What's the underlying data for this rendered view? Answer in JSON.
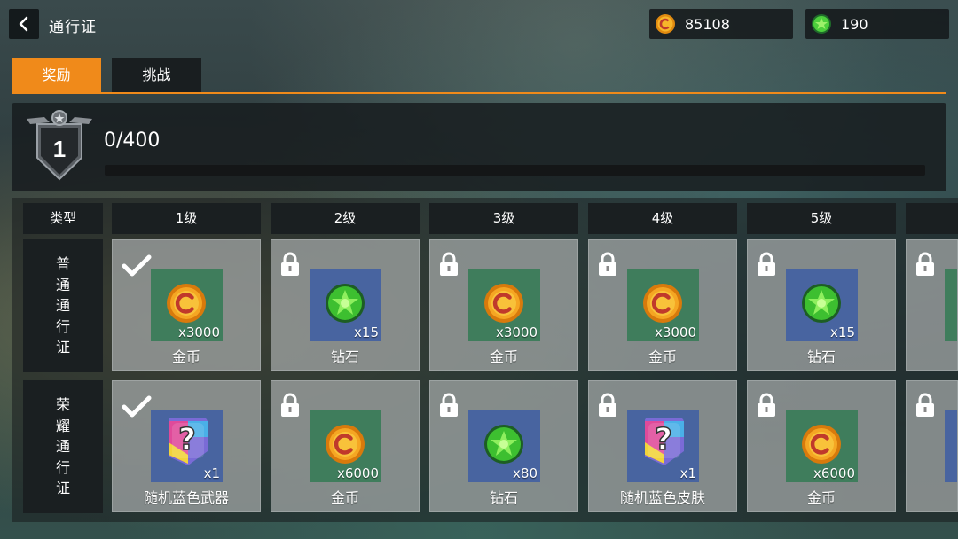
{
  "header": {
    "title": "通行证"
  },
  "currencies": [
    {
      "icon": "gold-coin-icon",
      "value": "85108"
    },
    {
      "icon": "green-gem-icon",
      "value": "190"
    }
  ],
  "tabs": [
    {
      "label": "奖励",
      "active": true
    },
    {
      "label": "挑战",
      "active": false
    }
  ],
  "level": {
    "number": "1",
    "progress_text": "0/400",
    "progress_fraction": 0
  },
  "table": {
    "type_header": "类型",
    "level_headers": [
      "1级",
      "2级",
      "3级",
      "4级",
      "5级"
    ],
    "rows": [
      {
        "label": "普通通行证",
        "label_chars": [
          "普",
          "通",
          "通",
          "行",
          "证"
        ],
        "cells": [
          {
            "status": "claimed",
            "item": "gold-coin-icon",
            "bg": "green",
            "qty": "x3000",
            "name": "金币"
          },
          {
            "status": "locked",
            "item": "green-gem-icon",
            "bg": "blue",
            "qty": "x15",
            "name": "钻石"
          },
          {
            "status": "locked",
            "item": "gold-coin-icon",
            "bg": "green",
            "qty": "x3000",
            "name": "金币"
          },
          {
            "status": "locked",
            "item": "gold-coin-icon",
            "bg": "green",
            "qty": "x3000",
            "name": "金币"
          },
          {
            "status": "locked",
            "item": "green-gem-icon",
            "bg": "blue",
            "qty": "x15",
            "name": "钻石"
          },
          {
            "status": "locked",
            "item": "",
            "bg": "green",
            "qty": "",
            "name": ""
          }
        ]
      },
      {
        "label": "荣耀通行证",
        "label_chars": [
          "荣",
          "耀",
          "通",
          "行",
          "证"
        ],
        "cells": [
          {
            "status": "claimed",
            "item": "mystery-box-icon",
            "bg": "blue",
            "qty": "x1",
            "name": "随机蓝色武器"
          },
          {
            "status": "locked",
            "item": "gold-coin-icon",
            "bg": "green",
            "qty": "x6000",
            "name": "金币"
          },
          {
            "status": "locked",
            "item": "green-gem-icon",
            "bg": "blue",
            "qty": "x80",
            "name": "钻石"
          },
          {
            "status": "locked",
            "item": "mystery-box-icon",
            "bg": "blue",
            "qty": "x1",
            "name": "随机蓝色皮肤"
          },
          {
            "status": "locked",
            "item": "gold-coin-icon",
            "bg": "green",
            "qty": "x6000",
            "name": "金币"
          },
          {
            "status": "locked",
            "item": "",
            "bg": "blue",
            "qty": "",
            "name": ""
          }
        ]
      }
    ]
  },
  "colors": {
    "accent": "#f08a1a",
    "panel_dark": "#1a1f21",
    "reward_green": "#3f7d5c",
    "reward_blue": "#4864a0"
  }
}
